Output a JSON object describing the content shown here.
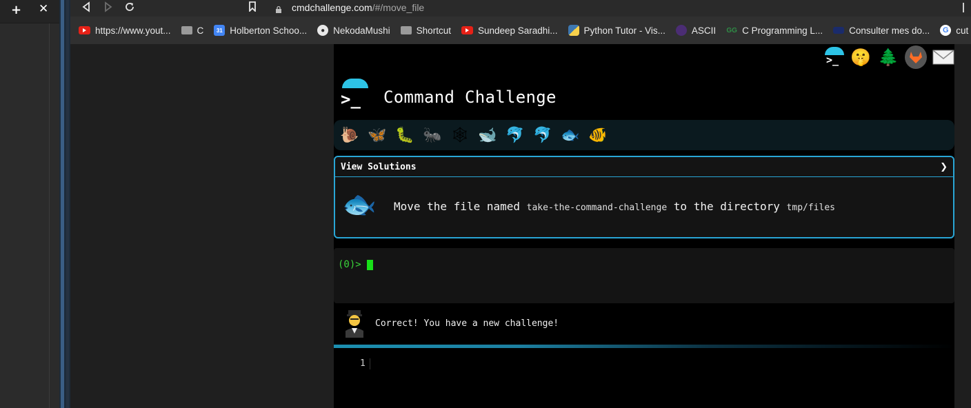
{
  "sidebar": {
    "new_tab_glyph": "+",
    "close_glyph": "✕"
  },
  "browser": {
    "url_host": "cmdchallenge.com",
    "url_path": "/#/move_file",
    "bookmarks": [
      {
        "label": "https://www.yout...",
        "icon": "youtube-icon"
      },
      {
        "label": "C",
        "icon": "folder-icon"
      },
      {
        "label": "Holberton Schoo...",
        "icon": "calendar-icon"
      },
      {
        "label": "NekodaMushi",
        "icon": "github-icon"
      },
      {
        "label": "Shortcut",
        "icon": "folder-icon"
      },
      {
        "label": "Sundeep Saradhi...",
        "icon": "youtube-icon"
      },
      {
        "label": "Python Tutor - Vis...",
        "icon": "python-icon"
      },
      {
        "label": "ASCII",
        "icon": "ascii-icon"
      },
      {
        "label": "C Programming L...",
        "icon": "gfg-icon"
      },
      {
        "label": "Consulter mes do...",
        "icon": "consulter-icon"
      },
      {
        "label": "cut",
        "icon": "google-icon"
      }
    ]
  },
  "app": {
    "title": "Command Challenge",
    "logo_glyph": ">_",
    "top_icons": [
      "terminal-icon",
      "shushing-face-icon",
      "tree-icon",
      "gitlab-icon",
      "envelope-icon"
    ],
    "challenge_icons": [
      "🐌",
      "🦋",
      "🐛",
      "🐜",
      "🕸",
      "🐋",
      "🐬",
      "🐬",
      "🐟",
      "🐠"
    ],
    "solutions": {
      "label": "View Solutions",
      "chevron": "❯",
      "task_prefix": "Move the file named ",
      "task_file": "take-the-command-challenge",
      "task_middle": " to the directory ",
      "task_dir": "tmp/files"
    },
    "terminal": {
      "prompt": "(0)>"
    },
    "message": "Correct! You have a new challenge!",
    "editor": {
      "line_number": "1"
    },
    "colors": {
      "accent": "#29a6d6",
      "prompt": "#3ad53a"
    }
  }
}
